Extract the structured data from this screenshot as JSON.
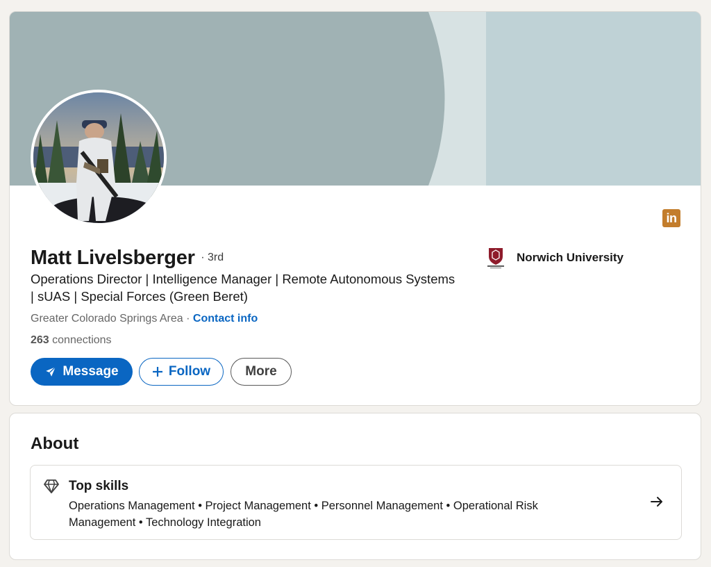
{
  "profile": {
    "name": "Matt Livelsberger",
    "degree": "· 3rd",
    "headline": "Operations Director | Intelligence Manager | Remote Autonomous Systems | sUAS | Special Forces (Green Beret)",
    "location": "Greater Colorado Springs Area ·",
    "contact_info": "Contact info",
    "connections_count": "263",
    "connections_label": "connections",
    "education": "Norwich University"
  },
  "actions": {
    "message": "Message",
    "follow": "Follow",
    "more": "More"
  },
  "about": {
    "title": "About",
    "top_skills_title": "Top skills",
    "top_skills": "Operations Management • Project Management • Personnel Management • Operational Risk Management • Technology Integration"
  },
  "brand": {
    "linkedin_logo_text": "in",
    "accent": "#0a66c2",
    "logo_color": "#c37d2c"
  },
  "icons": [
    "linkedin-logo-icon",
    "send-icon",
    "plus-icon",
    "diamond-icon",
    "arrow-right-icon",
    "norwich-logo-icon"
  ]
}
